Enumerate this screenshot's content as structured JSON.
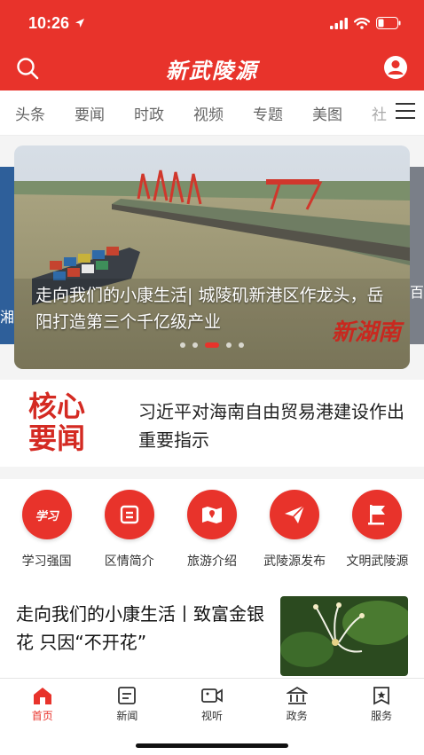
{
  "status_bar": {
    "time": "10:26"
  },
  "header": {
    "logo_text": "新武陵源"
  },
  "tabs": [
    {
      "label": "头条"
    },
    {
      "label": "要闻"
    },
    {
      "label": "时政"
    },
    {
      "label": "视频"
    },
    {
      "label": "专题"
    },
    {
      "label": "美图"
    },
    {
      "label": "社"
    }
  ],
  "carousel": {
    "caption": "走向我们的小康生活| 城陵矶新港区作龙头，岳阳打造第三个千亿级产业",
    "watermark": "新湖南",
    "left_peek_text": "湘",
    "right_peek_text": "百",
    "slide_count": 5,
    "active_index": 2
  },
  "core_news": {
    "logo_line1": "核心",
    "logo_line2": "要闻",
    "headline": "习近平对海南自由贸易港建设作出重要指示"
  },
  "services": [
    {
      "label": "学习强国",
      "icon": "xuexi-icon"
    },
    {
      "label": "区情简介",
      "icon": "document-icon"
    },
    {
      "label": "旅游介绍",
      "icon": "map-icon"
    },
    {
      "label": "武陵源发布",
      "icon": "paper-plane-icon"
    },
    {
      "label": "文明武陵源",
      "icon": "flag-icon"
    }
  ],
  "news_item": {
    "title": "走向我们的小康生活丨致富金银花 只因“不开花”"
  },
  "bottom_nav": [
    {
      "label": "首页",
      "icon": "home-icon",
      "active": true
    },
    {
      "label": "新闻",
      "icon": "news-icon",
      "active": false
    },
    {
      "label": "视听",
      "icon": "video-icon",
      "active": false
    },
    {
      "label": "政务",
      "icon": "government-icon",
      "active": false
    },
    {
      "label": "服务",
      "icon": "service-icon",
      "active": false
    }
  ],
  "colors": {
    "brand_red": "#e8332b",
    "text_dark": "#222222",
    "tab_gray": "#666666"
  }
}
